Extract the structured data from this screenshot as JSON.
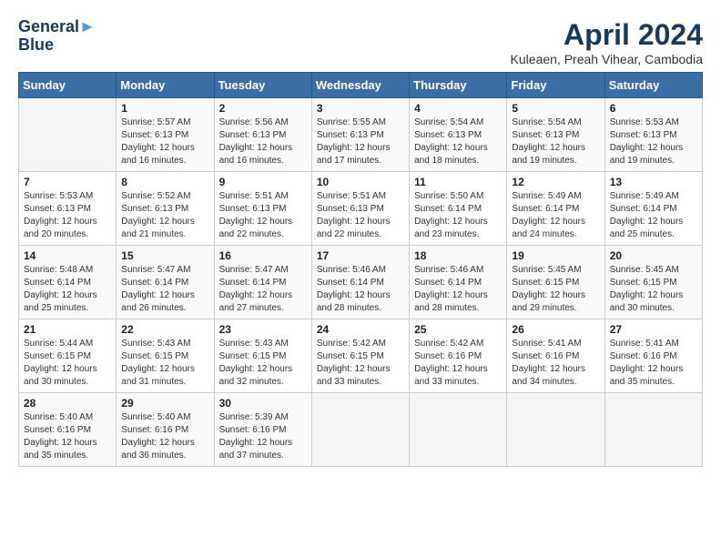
{
  "logo": {
    "line1": "General",
    "line2": "Blue"
  },
  "title": "April 2024",
  "subtitle": "Kuleaen, Preah Vihear, Cambodia",
  "headers": [
    "Sunday",
    "Monday",
    "Tuesday",
    "Wednesday",
    "Thursday",
    "Friday",
    "Saturday"
  ],
  "weeks": [
    [
      {
        "day": "",
        "sunrise": "",
        "sunset": "",
        "daylight": ""
      },
      {
        "day": "1",
        "sunrise": "Sunrise: 5:57 AM",
        "sunset": "Sunset: 6:13 PM",
        "daylight": "Daylight: 12 hours and 16 minutes."
      },
      {
        "day": "2",
        "sunrise": "Sunrise: 5:56 AM",
        "sunset": "Sunset: 6:13 PM",
        "daylight": "Daylight: 12 hours and 16 minutes."
      },
      {
        "day": "3",
        "sunrise": "Sunrise: 5:55 AM",
        "sunset": "Sunset: 6:13 PM",
        "daylight": "Daylight: 12 hours and 17 minutes."
      },
      {
        "day": "4",
        "sunrise": "Sunrise: 5:54 AM",
        "sunset": "Sunset: 6:13 PM",
        "daylight": "Daylight: 12 hours and 18 minutes."
      },
      {
        "day": "5",
        "sunrise": "Sunrise: 5:54 AM",
        "sunset": "Sunset: 6:13 PM",
        "daylight": "Daylight: 12 hours and 19 minutes."
      },
      {
        "day": "6",
        "sunrise": "Sunrise: 5:53 AM",
        "sunset": "Sunset: 6:13 PM",
        "daylight": "Daylight: 12 hours and 19 minutes."
      }
    ],
    [
      {
        "day": "7",
        "sunrise": "Sunrise: 5:53 AM",
        "sunset": "Sunset: 6:13 PM",
        "daylight": "Daylight: 12 hours and 20 minutes."
      },
      {
        "day": "8",
        "sunrise": "Sunrise: 5:52 AM",
        "sunset": "Sunset: 6:13 PM",
        "daylight": "Daylight: 12 hours and 21 minutes."
      },
      {
        "day": "9",
        "sunrise": "Sunrise: 5:51 AM",
        "sunset": "Sunset: 6:13 PM",
        "daylight": "Daylight: 12 hours and 22 minutes."
      },
      {
        "day": "10",
        "sunrise": "Sunrise: 5:51 AM",
        "sunset": "Sunset: 6:13 PM",
        "daylight": "Daylight: 12 hours and 22 minutes."
      },
      {
        "day": "11",
        "sunrise": "Sunrise: 5:50 AM",
        "sunset": "Sunset: 6:14 PM",
        "daylight": "Daylight: 12 hours and 23 minutes."
      },
      {
        "day": "12",
        "sunrise": "Sunrise: 5:49 AM",
        "sunset": "Sunset: 6:14 PM",
        "daylight": "Daylight: 12 hours and 24 minutes."
      },
      {
        "day": "13",
        "sunrise": "Sunrise: 5:49 AM",
        "sunset": "Sunset: 6:14 PM",
        "daylight": "Daylight: 12 hours and 25 minutes."
      }
    ],
    [
      {
        "day": "14",
        "sunrise": "Sunrise: 5:48 AM",
        "sunset": "Sunset: 6:14 PM",
        "daylight": "Daylight: 12 hours and 25 minutes."
      },
      {
        "day": "15",
        "sunrise": "Sunrise: 5:47 AM",
        "sunset": "Sunset: 6:14 PM",
        "daylight": "Daylight: 12 hours and 26 minutes."
      },
      {
        "day": "16",
        "sunrise": "Sunrise: 5:47 AM",
        "sunset": "Sunset: 6:14 PM",
        "daylight": "Daylight: 12 hours and 27 minutes."
      },
      {
        "day": "17",
        "sunrise": "Sunrise: 5:46 AM",
        "sunset": "Sunset: 6:14 PM",
        "daylight": "Daylight: 12 hours and 28 minutes."
      },
      {
        "day": "18",
        "sunrise": "Sunrise: 5:46 AM",
        "sunset": "Sunset: 6:14 PM",
        "daylight": "Daylight: 12 hours and 28 minutes."
      },
      {
        "day": "19",
        "sunrise": "Sunrise: 5:45 AM",
        "sunset": "Sunset: 6:15 PM",
        "daylight": "Daylight: 12 hours and 29 minutes."
      },
      {
        "day": "20",
        "sunrise": "Sunrise: 5:45 AM",
        "sunset": "Sunset: 6:15 PM",
        "daylight": "Daylight: 12 hours and 30 minutes."
      }
    ],
    [
      {
        "day": "21",
        "sunrise": "Sunrise: 5:44 AM",
        "sunset": "Sunset: 6:15 PM",
        "daylight": "Daylight: 12 hours and 30 minutes."
      },
      {
        "day": "22",
        "sunrise": "Sunrise: 5:43 AM",
        "sunset": "Sunset: 6:15 PM",
        "daylight": "Daylight: 12 hours and 31 minutes."
      },
      {
        "day": "23",
        "sunrise": "Sunrise: 5:43 AM",
        "sunset": "Sunset: 6:15 PM",
        "daylight": "Daylight: 12 hours and 32 minutes."
      },
      {
        "day": "24",
        "sunrise": "Sunrise: 5:42 AM",
        "sunset": "Sunset: 6:15 PM",
        "daylight": "Daylight: 12 hours and 33 minutes."
      },
      {
        "day": "25",
        "sunrise": "Sunrise: 5:42 AM",
        "sunset": "Sunset: 6:16 PM",
        "daylight": "Daylight: 12 hours and 33 minutes."
      },
      {
        "day": "26",
        "sunrise": "Sunrise: 5:41 AM",
        "sunset": "Sunset: 6:16 PM",
        "daylight": "Daylight: 12 hours and 34 minutes."
      },
      {
        "day": "27",
        "sunrise": "Sunrise: 5:41 AM",
        "sunset": "Sunset: 6:16 PM",
        "daylight": "Daylight: 12 hours and 35 minutes."
      }
    ],
    [
      {
        "day": "28",
        "sunrise": "Sunrise: 5:40 AM",
        "sunset": "Sunset: 6:16 PM",
        "daylight": "Daylight: 12 hours and 35 minutes."
      },
      {
        "day": "29",
        "sunrise": "Sunrise: 5:40 AM",
        "sunset": "Sunset: 6:16 PM",
        "daylight": "Daylight: 12 hours and 36 minutes."
      },
      {
        "day": "30",
        "sunrise": "Sunrise: 5:39 AM",
        "sunset": "Sunset: 6:16 PM",
        "daylight": "Daylight: 12 hours and 37 minutes."
      },
      {
        "day": "",
        "sunrise": "",
        "sunset": "",
        "daylight": ""
      },
      {
        "day": "",
        "sunrise": "",
        "sunset": "",
        "daylight": ""
      },
      {
        "day": "",
        "sunrise": "",
        "sunset": "",
        "daylight": ""
      },
      {
        "day": "",
        "sunrise": "",
        "sunset": "",
        "daylight": ""
      }
    ]
  ]
}
